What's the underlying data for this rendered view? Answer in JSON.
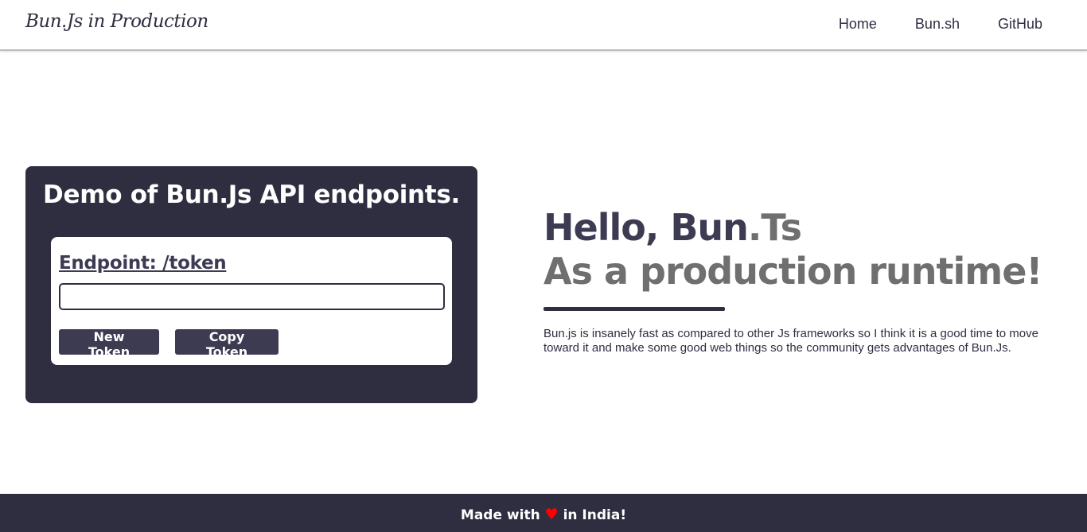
{
  "header": {
    "brand": "Bun.Js in Production",
    "nav": [
      {
        "label": "Home"
      },
      {
        "label": "Bun.sh"
      },
      {
        "label": "GitHub"
      }
    ]
  },
  "demo": {
    "title": "Demo of Bun.Js API endpoints.",
    "endpoint_label": "Endpoint: /token",
    "token_value": "",
    "token_placeholder": "",
    "new_token_label": "New Token",
    "copy_token_label": "Copy Token"
  },
  "hero": {
    "line1_main": "Hello, Bun",
    "line1_accent": ".Ts",
    "line2": "As a production runtime!",
    "description": "Bun.js is insanely fast as compared to other Js frameworks so I think it is a good time to move toward it and make some good web things so the community gets advantages of Bun.Js."
  },
  "footer": {
    "text_before": "Made with",
    "heart_icon": "heart-icon",
    "text_after": "in India!"
  },
  "colors": {
    "primary_dark": "#2f2e41",
    "accent_gray": "#6f6f6f",
    "heart_red": "#ff0000"
  }
}
